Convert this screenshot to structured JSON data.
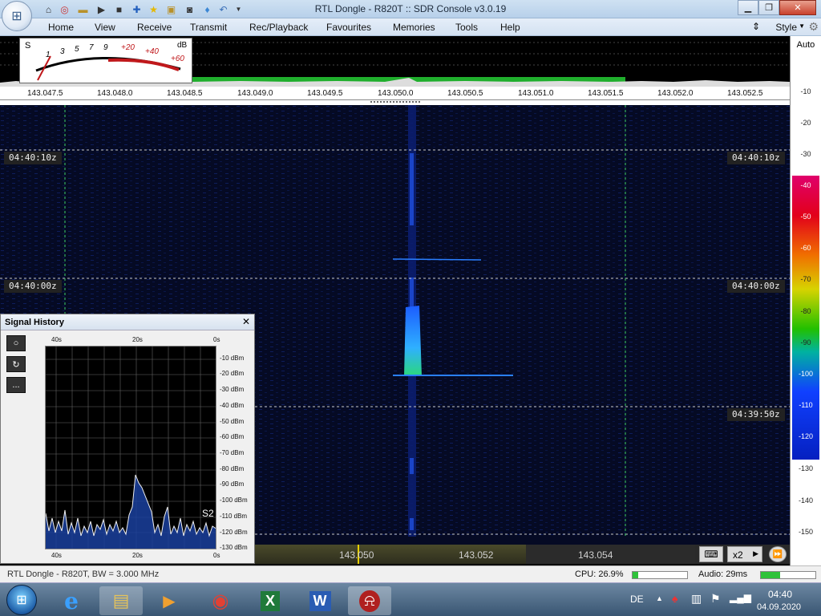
{
  "window": {
    "title": "RTL Dongle - R820T :: SDR Console v3.0.19"
  },
  "menu": [
    "Home",
    "View",
    "Receive",
    "Transmit",
    "Rec/Playback",
    "Favourites",
    "Memories",
    "Tools",
    "Help"
  ],
  "style_label": "Style",
  "scale_mode": "Auto",
  "meter": {
    "s_label": "S",
    "db_label": "dB",
    "marks": [
      "1",
      "3",
      "5",
      "7",
      "9",
      "+20",
      "+40",
      "+60"
    ]
  },
  "freq_ticks": [
    "143.047.5",
    "143.048.0",
    "143.048.5",
    "143.049.0",
    "143.049.5",
    "143.050.0",
    "143.050.5",
    "143.051.0",
    "143.051.5",
    "143.052.0",
    "143.052.5"
  ],
  "time_labels": [
    "04:40:10z",
    "04:40:00z",
    "04:39:50z"
  ],
  "db_scale": [
    "-10",
    "-20",
    "-30",
    "-40",
    "-50",
    "-60",
    "-70",
    "-80",
    "-90",
    "-100",
    "-110",
    "-120",
    "-130",
    "-140",
    "-150"
  ],
  "band_freqs": [
    "143.050",
    "143.052",
    "143.054"
  ],
  "zoom": "x2",
  "signal_history": {
    "title": "Signal History",
    "time_ticks": [
      "40s",
      "20s",
      "0s"
    ],
    "db_ticks": [
      "-10 dBm",
      "-20 dBm",
      "-30 dBm",
      "-40 dBm",
      "-50 dBm",
      "-60 dBm",
      "-70 dBm",
      "-80 dBm",
      "-90 dBm",
      "-100 dBm",
      "-110 dBm",
      "-120 dBm",
      "-130 dBm"
    ],
    "s_reading": "S2",
    "more_label": "..."
  },
  "status": {
    "device": "RTL Dongle - R820T, BW = 3.000 MHz",
    "cpu": "CPU: 26.9%",
    "cpu_fill": 0.1,
    "audio": "Audio: 29ms",
    "audio_fill": 0.35
  },
  "taskbar": {
    "lang": "DE",
    "time": "04:40",
    "date": "04.09.2020"
  },
  "colors": {
    "accent": "#1f6fd1",
    "waterfall_bg": "#050a24",
    "signal": "#2a7fff"
  }
}
